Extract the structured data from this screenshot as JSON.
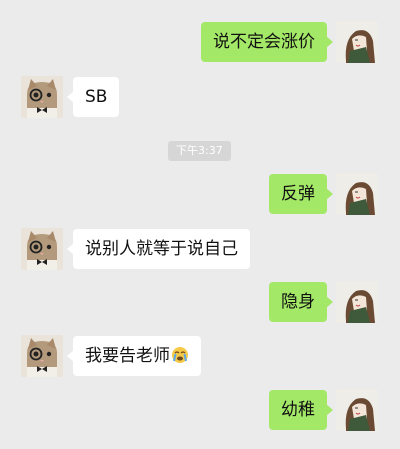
{
  "chat": {
    "timestamp": "下午3:37",
    "messages": [
      {
        "side": "out",
        "text": "说不定会涨价"
      },
      {
        "side": "in",
        "text": "SB"
      },
      {
        "side": "out",
        "text": "反弹"
      },
      {
        "side": "in",
        "text": "说别人就等于说自己"
      },
      {
        "side": "out",
        "text": "隐身"
      },
      {
        "side": "in",
        "text": "我要告老师",
        "emoji": "crying-face-emoji"
      },
      {
        "side": "out",
        "text": "幼稚"
      }
    ]
  },
  "colors": {
    "background": "#ebebeb",
    "outgoing_bubble": "#a4e867",
    "incoming_bubble": "#ffffff",
    "timestamp_bg": "#d6d6d6"
  },
  "avatars": {
    "self": "girl-portrait-avatar",
    "friend": "cat-monocle-avatar"
  }
}
